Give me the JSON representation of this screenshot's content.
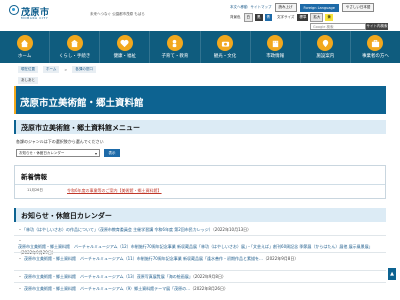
{
  "header": {
    "logo_name": "茂原市",
    "logo_sub": "MOBARA CITY",
    "catch": "未来へつなぐ 公園都市茂原 もばら",
    "util_links": [
      "本文へ移動",
      "サイトマップ"
    ],
    "util_chips": [
      "読み上げ",
      "Foreign Language",
      "やさしい日本語"
    ],
    "bgcolor_label": "背景色",
    "bg_buttons": [
      "白",
      "黒",
      "青"
    ],
    "fontsize_label": "文字サイズ",
    "font_buttons": [
      "標準",
      "拡大"
    ],
    "yellow_button": "黄",
    "search_placeholder": "Google 検索",
    "search_button": "サイト内検索"
  },
  "nav": {
    "items": [
      {
        "label": "ホーム",
        "icon": "home-icon"
      },
      {
        "label": "くらし・手続き",
        "icon": "house-icon"
      },
      {
        "label": "健康・福祉",
        "icon": "heart-icon"
      },
      {
        "label": "子育て・教育",
        "icon": "child-icon"
      },
      {
        "label": "観光・文化",
        "icon": "camera-icon"
      },
      {
        "label": "市政情報",
        "icon": "building-icon"
      },
      {
        "label": "施設案内",
        "icon": "map-icon"
      },
      {
        "label": "事業者の方へ",
        "icon": "briefcase-icon"
      }
    ]
  },
  "breadcrumb": [
    "現在位置",
    "ホーム",
    "各課の窓口"
  ],
  "small_badge": "あしあと",
  "page_title": "茂原市立美術館・郷土資料館",
  "menu_section": {
    "heading": "茂原市立美術館・郷土資料館メニュー",
    "text": "各課のジャンルは下の選択肢から選んでください",
    "select_value": "お知らせ・休館日カレンダー",
    "button": "表示"
  },
  "news": {
    "heading": "新着情報",
    "date": "11月26日",
    "link": "令和6年度の事業等のご案内【美術館・郷土資料館】"
  },
  "notices_section": {
    "heading": "お知らせ・休館日カレンダー",
    "items": [
      {
        "text": "「林功（はやしいさお）の作品について」（茂原市教育委員会 主催学習講 令和6年度 第2回市民カレッジ）",
        "date": "（2022年10月13日）"
      },
      {
        "text": "茂原市立美術館・郷土資料館　バーチャルミュージアム（12）市制施行70周年記念事業 新収蔵品展「林功（はやしいさお）展」・「文芸えば」創刊60周記念 季節展（からはたん）展他 展示風景展」",
        "date": "（2022年9月29日）"
      },
      {
        "text": "茂原市立美術館・郷土資料館　バーチャルミュージアム（11）市制施行70周年記念事業 新収蔵品展「逢水善作・初期作品と素描を…",
        "date": "（2022年9月8日）"
      },
      {
        "text": "茂原市立美術館・郷土資料館　バーチャルミュージアム（13）茂原写真展覧展「海の絵画展」",
        "date": "（2022年9月8日）"
      },
      {
        "text": "茂原市立美術館・郷土資料館　バーチャルミュージアム（9）郷土資料館テーマ展「茂原の…",
        "date": "（2022年8月26日）"
      }
    ]
  },
  "colors": {
    "nav_bg": "#0f5c7e",
    "nav_icon": "#f2a81d",
    "title_bg": "#0d6391",
    "section_bg": "#dcebf5"
  }
}
